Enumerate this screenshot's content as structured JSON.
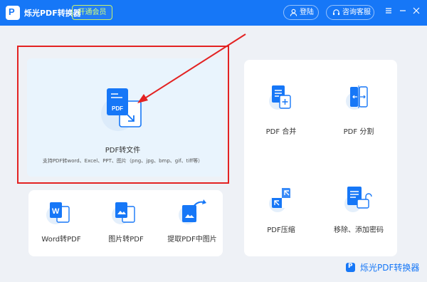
{
  "titlebar": {
    "app_title": "烁光PDF转换器",
    "vip_label": "开通会员",
    "login_label": "登陆",
    "service_label": "咨询客服"
  },
  "hero": {
    "title": "PDF转文件",
    "subtitle": "支持PDF转word、Excel、PPT、图片（png、jpg、bmp、gif、tiff等）",
    "icon_text": "PDF"
  },
  "tools_bottom": [
    {
      "label": "Word转PDF",
      "icon": "word-to-pdf-icon"
    },
    {
      "label": "图片转PDF",
      "icon": "image-to-pdf-icon"
    },
    {
      "label": "提取PDF中图片",
      "icon": "extract-image-icon"
    }
  ],
  "tools_right": [
    {
      "label": "PDF 合并",
      "icon": "merge-icon"
    },
    {
      "label": "PDF 分割",
      "icon": "split-icon"
    },
    {
      "label": "PDF压缩",
      "icon": "compress-icon"
    },
    {
      "label": "移除、添加密码",
      "icon": "unlock-icon"
    }
  ],
  "footer": {
    "brand": "烁光PDF转换器"
  },
  "colors": {
    "brand": "#1677f7",
    "highlight": "#e32222",
    "vip": "#c9f26a"
  }
}
